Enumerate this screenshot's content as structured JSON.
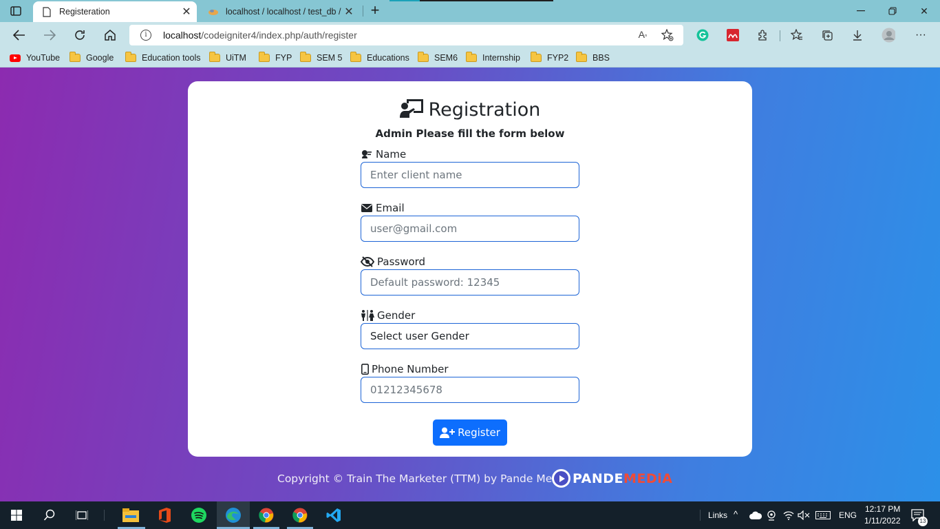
{
  "browser": {
    "tabs": [
      {
        "title": "Registeration",
        "active": true
      },
      {
        "title": "localhost / localhost / test_db / u",
        "active": false
      }
    ],
    "url_host": "localhost",
    "url_path": "/codeigniter4/index.php/auth/register",
    "bookmarks": [
      "YouTube",
      "Google",
      "Education tools",
      "UiTM",
      "FYP",
      "SEM 5",
      "Educations",
      "SEM6",
      "Internship",
      "FYP2",
      "BBS"
    ]
  },
  "form": {
    "title": "Registration",
    "subtitle": "Admin Please fill the form below",
    "fields": [
      {
        "label": "Name",
        "placeholder": "Enter client name",
        "icon": "id-card-icon"
      },
      {
        "label": "Email",
        "placeholder": "user@gmail.com",
        "icon": "envelope-icon"
      },
      {
        "label": "Password",
        "placeholder": "Default password: 12345",
        "icon": "eye-slash-icon"
      },
      {
        "label": "Gender",
        "value": "Select user Gender",
        "icon": "restroom-icon"
      },
      {
        "label": "Phone Number",
        "placeholder": "01212345678",
        "icon": "mobile-icon"
      }
    ],
    "submit_label": "Register"
  },
  "footer": {
    "copyright": "Copyright © Train The Marketer (TTM) by Pande Media",
    "logo_part1": "PANDE",
    "logo_part2": "MEDiA"
  },
  "taskbar": {
    "links_label": "Links",
    "language": "ENG",
    "time": "12:17 PM",
    "date": "1/11/2022",
    "notifications": "13"
  },
  "colors": {
    "primary": "#0d6efd",
    "input_border": "#1c64d6",
    "gradient_start": "#8c2bb0",
    "gradient_end": "#2c90e8",
    "logo_accent": "#f04b37"
  }
}
